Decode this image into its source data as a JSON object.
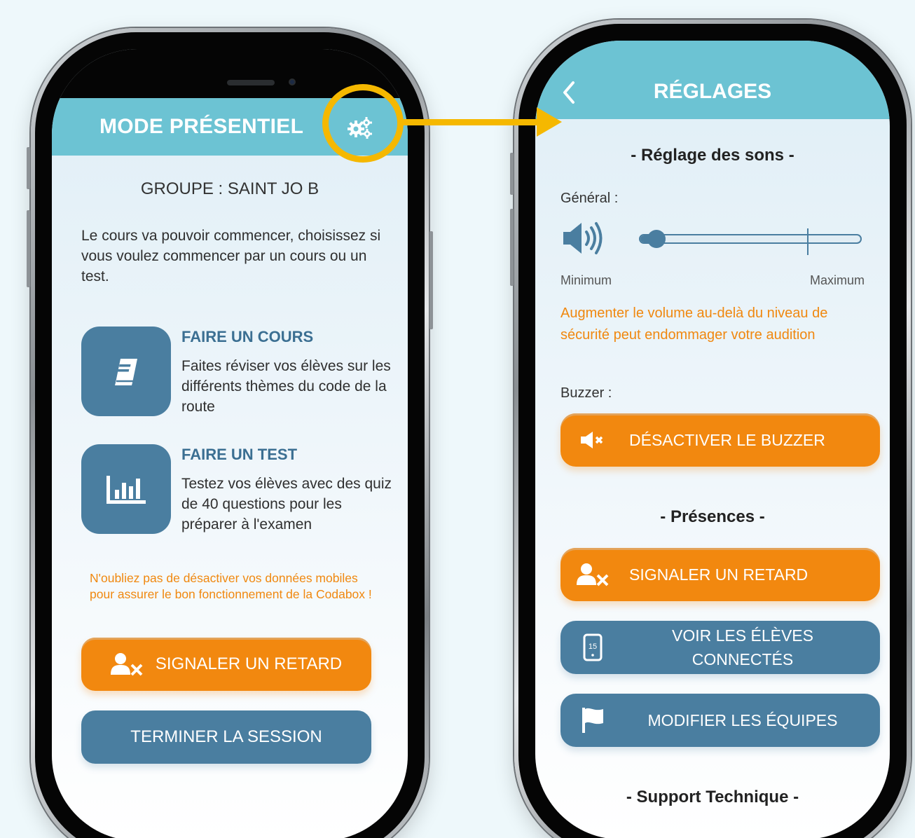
{
  "left_phone": {
    "header_title": "MODE PRÉSENTIEL",
    "group_label": "GROUPE : SAINT JO B",
    "intro_text": "Le cours va pouvoir commencer, choisissez si vous voulez commencer par un cours ou un test.",
    "modes": [
      {
        "title": "FAIRE UN COURS",
        "description": "Faites réviser vos élèves sur les différents thèmes du code de la route",
        "icon": "book-icon"
      },
      {
        "title": "FAIRE UN TEST",
        "description": "Testez vos élèves avec des quiz de 40 questions pour les préparer à l'examen",
        "icon": "bar-chart-icon"
      }
    ],
    "warning_text": "N'oubliez pas de désactiver vos données mobiles pour assurer le bon fonctionnement de la Codabox !",
    "late_button_label": "SIGNALER UN RETARD",
    "end_session_label": "TERMINER LA SESSION"
  },
  "right_phone": {
    "header_title": "RÉGLAGES",
    "sound_section_title": "- Réglage des sons -",
    "general_label": "Général :",
    "volume_level": 0.05,
    "volume_min_label": "Minimum",
    "volume_max_label": "Maximum",
    "volume_warning": "Augmenter le volume au-delà du niveau de sécurité peut endommager votre audition",
    "buzzer_label": "Buzzer :",
    "buzzer_button_label": "DÉSACTIVER LE BUZZER",
    "presence_section_title": "- Présences -",
    "late_button_label": "SIGNALER UN RETARD",
    "connected_button_label_line1": "VOIR LES ÉLÈVES",
    "connected_button_label_line2": "CONNECTÉS",
    "connected_icon_number": "15",
    "teams_button_label": "MODIFIER LES ÉQUIPES",
    "support_section_title": "- Support Technique -"
  },
  "colors": {
    "header_teal": "#6cc3d3",
    "accent_orange": "#f2880f",
    "primary_blue": "#4a7ea0",
    "highlight_yellow": "#f5b800",
    "warning_text": "#f0880f"
  }
}
